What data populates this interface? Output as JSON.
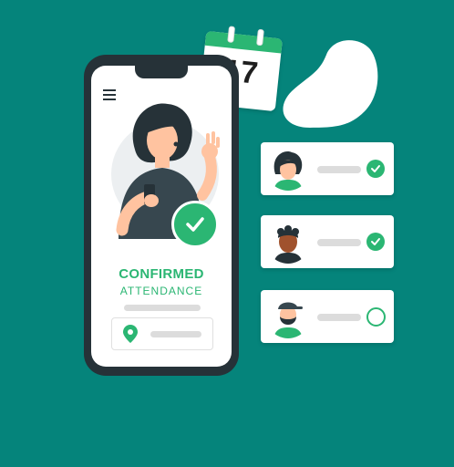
{
  "calendar": {
    "day": "17"
  },
  "screen": {
    "title": "CONFIRMED",
    "subtitle": "ATTENDANCE"
  },
  "attendees": [
    {
      "avatar": "woman-avatar-icon",
      "status": "confirmed"
    },
    {
      "avatar": "man-curly-avatar-icon",
      "status": "confirmed"
    },
    {
      "avatar": "bearded-man-avatar-icon",
      "status": "pending"
    }
  ],
  "colors": {
    "background": "#05847b",
    "accent": "#2bb673",
    "phone": "#263238",
    "placeholder": "#dcdcdc"
  }
}
